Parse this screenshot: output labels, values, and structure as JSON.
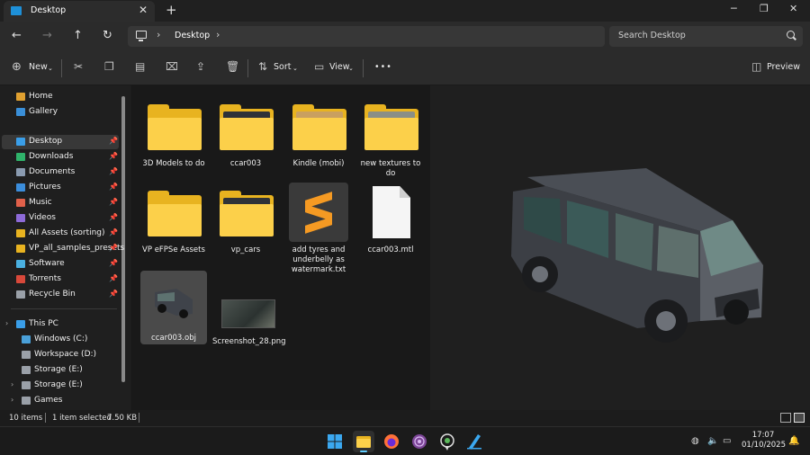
{
  "window": {
    "tab_title": "Desktop",
    "tab_close": "✕",
    "new_tab": "+",
    "minimize": "─",
    "maximize": "❐",
    "close": "✕"
  },
  "nav": {
    "back": "←",
    "forward": "→",
    "up": "↑",
    "refresh": "↻",
    "chevron": "›",
    "breadcrumb": "Desktop",
    "search_placeholder": "Search Desktop"
  },
  "commands": {
    "new": "New",
    "sort": "Sort",
    "view": "View",
    "more": "•••",
    "preview": "Preview",
    "icons": [
      "scissors-icon",
      "copy-icon",
      "paste-icon",
      "rename-icon",
      "share-icon",
      "delete-icon"
    ]
  },
  "sidebar": {
    "items": [
      {
        "label": "Home",
        "icon": "home-icon",
        "color": "#e0a030"
      },
      {
        "label": "Gallery",
        "icon": "gallery-icon",
        "color": "#3a8fd8"
      },
      {
        "label": "Desktop",
        "icon": "desktop-icon",
        "color": "#3a9ee8",
        "pinned": true,
        "selected": true
      },
      {
        "label": "Downloads",
        "icon": "download-icon",
        "color": "#2fb36a",
        "pinned": true
      },
      {
        "label": "Documents",
        "icon": "documents-icon",
        "color": "#8a9bb0",
        "pinned": true
      },
      {
        "label": "Pictures",
        "icon": "pictures-icon",
        "color": "#3b8ddb",
        "pinned": true
      },
      {
        "label": "Music",
        "icon": "music-icon",
        "color": "#e0604a",
        "pinned": true
      },
      {
        "label": "Videos",
        "icon": "videos-icon",
        "color": "#8d6ad8",
        "pinned": true
      },
      {
        "label": "All Assets (sorting)",
        "icon": "folder-icon",
        "color": "#e8b320",
        "pinned": true
      },
      {
        "label": "VP_all_samples_presets",
        "icon": "folder-icon",
        "color": "#e8b320",
        "pinned": true
      },
      {
        "label": "Software",
        "icon": "software-icon",
        "color": "#4ab0e0",
        "pinned": true
      },
      {
        "label": "Torrents",
        "icon": "torrents-icon",
        "color": "#d8483a",
        "pinned": true
      },
      {
        "label": "Recycle Bin",
        "icon": "recycle-bin-icon",
        "color": "#9aa0a8",
        "pinned": true
      },
      {
        "label": "This PC",
        "icon": "this-pc-icon",
        "color": "#3a9ee8"
      },
      {
        "label": "Windows (C:)",
        "icon": "drive-icon",
        "color": "#4aa0d8"
      },
      {
        "label": "Workspace (D:)",
        "icon": "drive-icon",
        "color": "#9aa0a8"
      },
      {
        "label": "Storage (E:)",
        "icon": "drive-icon",
        "color": "#9aa0a8"
      },
      {
        "label": "Storage (E:)",
        "icon": "drive-icon",
        "color": "#9aa0a8"
      },
      {
        "label": "Games",
        "icon": "drive-icon",
        "color": "#9aa0a8"
      }
    ]
  },
  "files": [
    {
      "name": "3D Models to do",
      "type": "folder"
    },
    {
      "name": "ccar003",
      "type": "folder-thumb"
    },
    {
      "name": "Kindle (mobi)",
      "type": "folder-thumb"
    },
    {
      "name": "new textures to do",
      "type": "folder-thumb"
    },
    {
      "name": "VP eFPSe Assets",
      "type": "folder"
    },
    {
      "name": "vp_cars",
      "type": "folder-thumb"
    },
    {
      "name": "add tyres and underbelly as watermark.txt",
      "type": "sublime"
    },
    {
      "name": "ccar003.mtl",
      "type": "document"
    },
    {
      "name": "ccar003.obj",
      "type": "model",
      "selected": true
    },
    {
      "name": "Screenshot_28.png",
      "type": "image"
    }
  ],
  "status": {
    "count": "10 items",
    "selection": "1 item selected",
    "size": "7.50 KB"
  },
  "taskbar": {
    "time": "17:07",
    "date": "01/10/2025"
  },
  "colors": {
    "accent": "#60cdff",
    "folder": "#fcd04a"
  }
}
